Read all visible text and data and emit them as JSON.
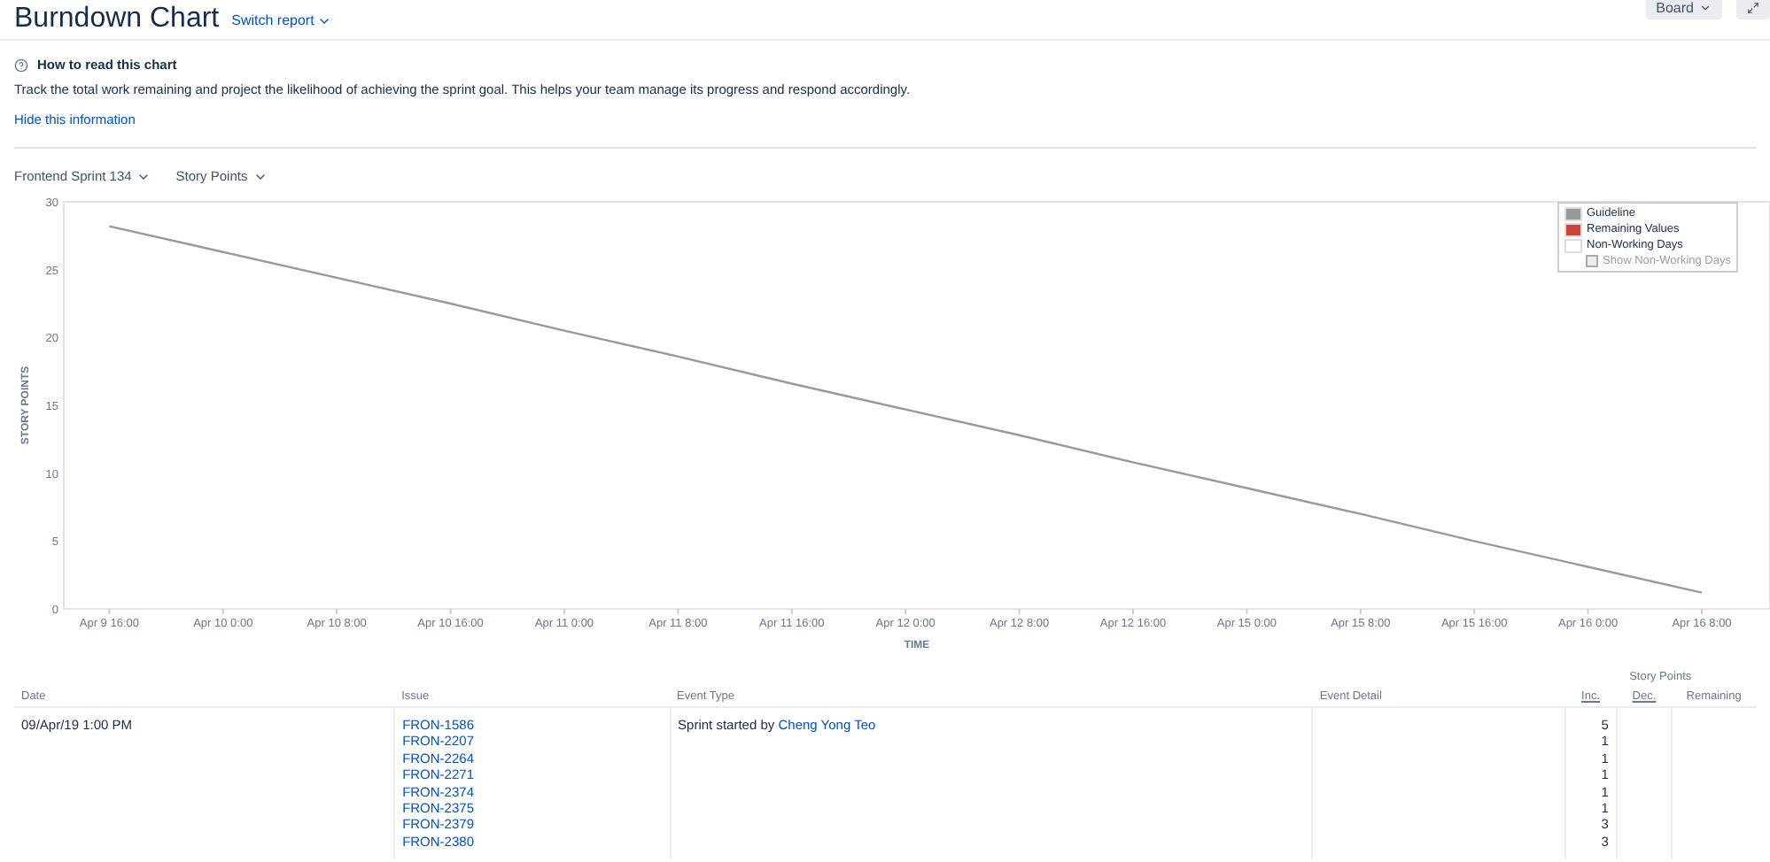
{
  "header": {
    "title": "Burndown Chart",
    "switch_label": "Switch report",
    "board_button": "Board"
  },
  "info": {
    "heading": "How to read this chart",
    "text": "Track the total work remaining and project the likelihood of achieving the sprint goal. This helps your team manage its progress and respond accordingly.",
    "hide_link": "Hide this information"
  },
  "filters": [
    {
      "label": "Frontend Sprint 134"
    },
    {
      "label": "Story Points"
    }
  ],
  "chart": {
    "legend": [
      {
        "label": "Remaining Values",
        "color": "#d04437"
      },
      {
        "label": "Non-Working Days",
        "color": "#ffffff"
      }
    ],
    "show_non_working": {
      "label": "Show Non-Working Days",
      "checked": false,
      "disabled": true
    },
    "chart_data": {
      "type": "line",
      "xlabel": "TIME",
      "ylabel": "STORY POINTS",
      "categories": [
        "Apr 9 16:00",
        "Apr 10 0:00",
        "Apr 10 8:00",
        "Apr 10 16:00",
        "Apr 11 0:00",
        "Apr 11 8:00",
        "Apr 11 16:00",
        "Apr 12 0:00",
        "Apr 12 8:00",
        "Apr 12 16:00",
        "Apr 15 0:00",
        "Apr 15 8:00",
        "Apr 15 16:00",
        "Apr 16 0:00",
        "Apr 16 8:00"
      ],
      "series": [
        {
          "name": "Guideline",
          "color": "#999999",
          "values": [
            28.2,
            26.3,
            24.4,
            22.5,
            20.5,
            18.6,
            16.6,
            14.7,
            12.8,
            10.8,
            8.9,
            7.0,
            5.0,
            3.1,
            1.2
          ]
        }
      ],
      "ylim": [
        0,
        30
      ],
      "yticks": [
        0,
        5,
        10,
        15,
        20,
        25,
        30
      ]
    }
  },
  "table": {
    "group_heading": "Story Points",
    "columns": [
      {
        "label": "Date"
      },
      {
        "label": "Issue"
      },
      {
        "label": "Event Type"
      },
      {
        "label": "Event Detail"
      },
      {
        "label": "Inc."
      },
      {
        "label": "Dec."
      },
      {
        "label": "Remaining"
      }
    ],
    "rows": [
      {
        "date": "09/Apr/19 1:00 PM",
        "issues": [
          "FRON-1586",
          "FRON-2207",
          "FRON-2264",
          "FRON-2271",
          "FRON-2374",
          "FRON-2375",
          "FRON-2379",
          "FRON-2380"
        ],
        "event_text": "Sprint started by",
        "event_user": "Cheng Yong Teo",
        "inc": [
          "5",
          "1",
          "1",
          "1",
          "1",
          "1",
          "3",
          "3"
        ]
      }
    ]
  }
}
